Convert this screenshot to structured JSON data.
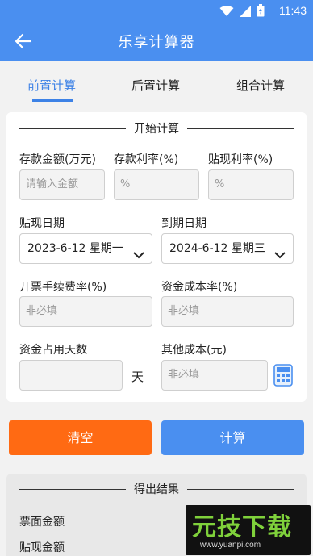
{
  "status_bar": {
    "time": "11:43"
  },
  "header": {
    "title": "乐享计算器"
  },
  "tabs": [
    {
      "label": "前置计算",
      "active": true
    },
    {
      "label": "后置计算",
      "active": false
    },
    {
      "label": "组合计算",
      "active": false
    }
  ],
  "form": {
    "section_title": "开始计算",
    "deposit_amount": {
      "label": "存款金额(万元)",
      "placeholder": "请输入金额"
    },
    "deposit_rate": {
      "label": "存款利率(%)",
      "placeholder": "%"
    },
    "discount_rate": {
      "label": "贴现利率(%)",
      "placeholder": "%"
    },
    "discount_date": {
      "label": "贴现日期",
      "value": "2023-6-12 星期一"
    },
    "maturity_date": {
      "label": "到期日期",
      "value": "2024-6-12 星期三"
    },
    "issue_fee_rate": {
      "label": "开票手续费率(%)",
      "placeholder": "非必填"
    },
    "capital_cost_rate": {
      "label": "资金成本率(%)",
      "placeholder": "非必填"
    },
    "capital_days": {
      "label": "资金占用天数",
      "unit": "天",
      "placeholder": ""
    },
    "other_cost": {
      "label": "其他成本(元)",
      "placeholder": "非必填"
    }
  },
  "buttons": {
    "clear": "清空",
    "calculate": "计算"
  },
  "result": {
    "section_title": "得出结果",
    "items": [
      "票面金额",
      "贴现金额"
    ]
  },
  "watermark": {
    "text": "元技下载",
    "url": "www.yuanpi.com"
  },
  "colors": {
    "primary": "#4a8ff0",
    "accent_orange": "#ff6a13",
    "tab_active": "#3d82e6"
  },
  "icons": [
    "wifi-icon",
    "signal-icon",
    "battery-icon",
    "back-arrow-icon",
    "chevron-down-icon",
    "calculator-icon"
  ]
}
